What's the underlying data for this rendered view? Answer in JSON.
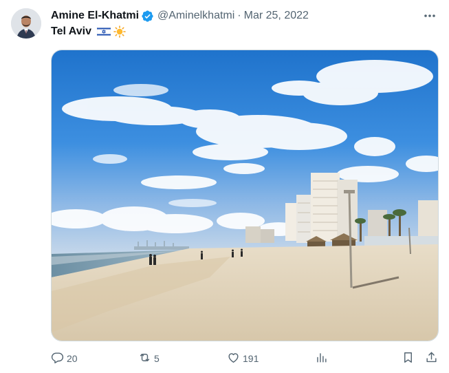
{
  "tweet": {
    "author_name": "Amine El-Khatmi",
    "handle": "@Aminelkhatmi",
    "separator": "·",
    "date": "Mar 25, 2022",
    "text": "Tel Aviv",
    "flag_icon": "israel-flag-icon",
    "sun_icon": "sun-icon"
  },
  "actions": {
    "replies": "20",
    "retweets": "5",
    "likes": "191"
  },
  "colors": {
    "verified": "#1d9bf0",
    "muted": "#536471",
    "text": "#0f1419"
  }
}
